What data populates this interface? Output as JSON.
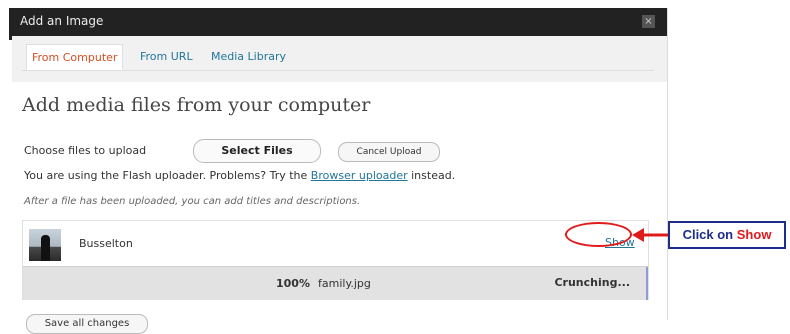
{
  "dialog": {
    "title": "Add an Image",
    "close_glyph": "×"
  },
  "tabs": [
    {
      "label": "From Computer",
      "active": true
    },
    {
      "label": "From URL",
      "active": false
    },
    {
      "label": "Media Library",
      "active": false
    }
  ],
  "upload": {
    "heading": "Add media files from your computer",
    "choose_label": "Choose files to upload",
    "select_files_label": "Select Files",
    "cancel_upload_label": "Cancel Upload",
    "flash_text_before": "You are using the Flash uploader. Problems? Try the",
    "flash_link": "Browser uploader",
    "flash_text_after": "instead.",
    "after_note": "After a file has been uploaded, you can add titles and descriptions."
  },
  "media_item": {
    "filename": "Busselton",
    "show_label": "Show",
    "progress_percent": "100%",
    "progress_file": "family.jpg",
    "status": "Crunching..."
  },
  "footer": {
    "save_all_label": "Save all changes"
  },
  "annotation": {
    "callout_prefix": "Click on",
    "callout_highlight": "Show"
  },
  "colors": {
    "titlebar": "#222222",
    "link": "#21759b",
    "active_tab": "#d54e21",
    "callout_red": "#e01b1b",
    "callout_blue": "#1f2d8a"
  }
}
